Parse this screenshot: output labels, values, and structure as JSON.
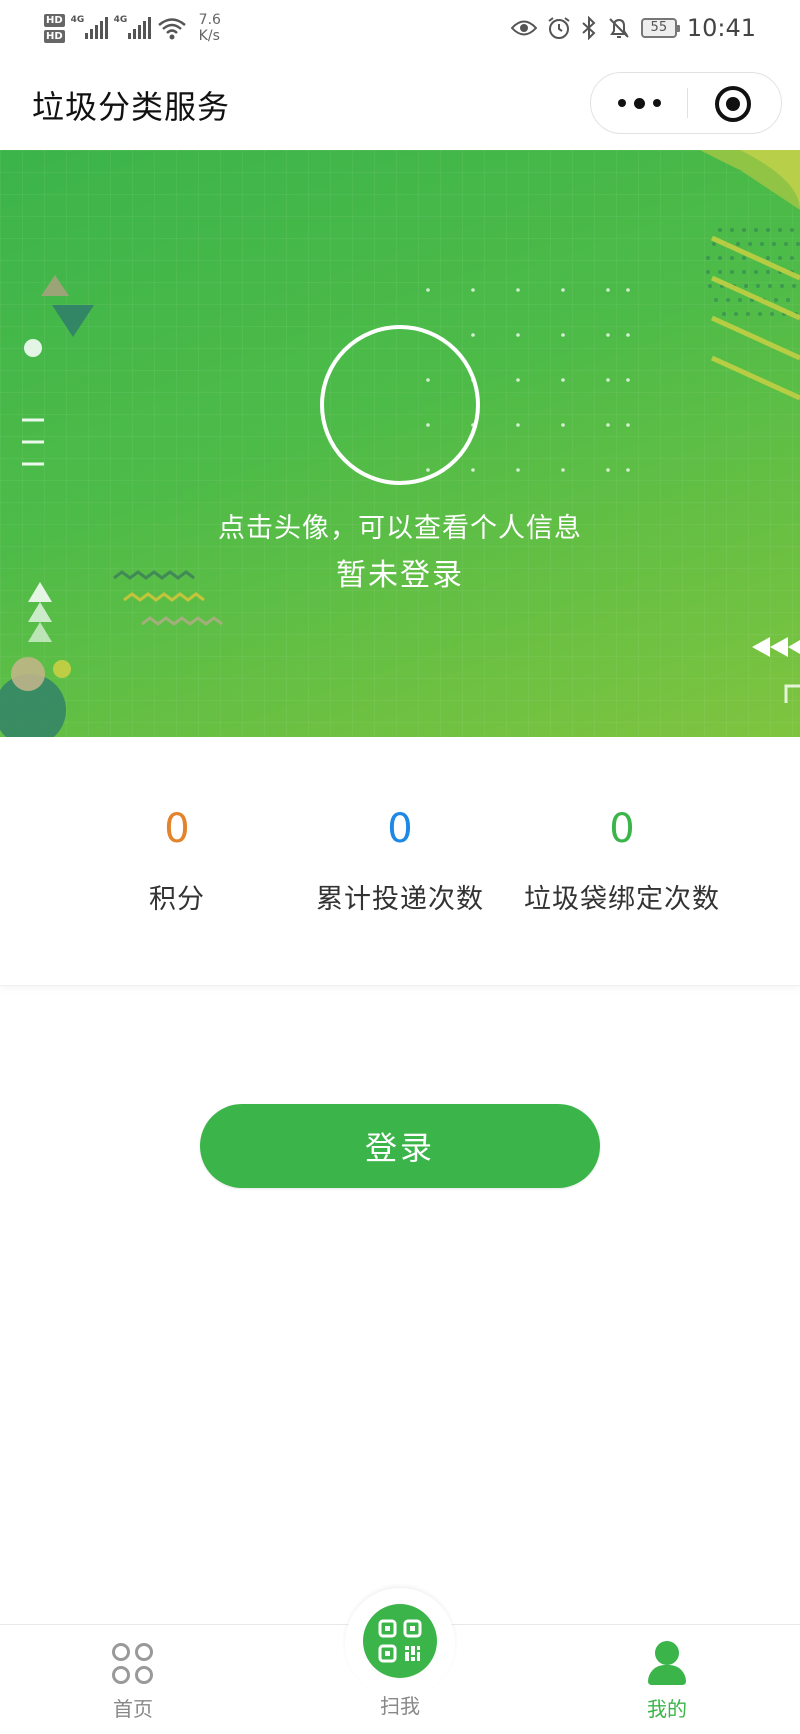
{
  "status_bar": {
    "hd1": "HD",
    "hd2": "HD",
    "net1": "4G",
    "net2": "4G",
    "speed_value": "7.6",
    "speed_unit": "K/s",
    "battery": "55",
    "time": "10:41"
  },
  "header": {
    "title": "垃圾分类服务"
  },
  "banner": {
    "hint": "点击头像，可以查看个人信息",
    "status": "暂未登录"
  },
  "stats": [
    {
      "value": "0",
      "label": "积分",
      "color": "#e3832b"
    },
    {
      "value": "0",
      "label": "累计投递次数",
      "color": "#1e88e5"
    },
    {
      "value": "0",
      "label": "垃圾袋绑定次数",
      "color": "#3bb54a"
    }
  ],
  "login_button": "登录",
  "tabbar": {
    "home": "首页",
    "scan": "扫我",
    "mine": "我的",
    "active_color": "#3bb54a"
  }
}
